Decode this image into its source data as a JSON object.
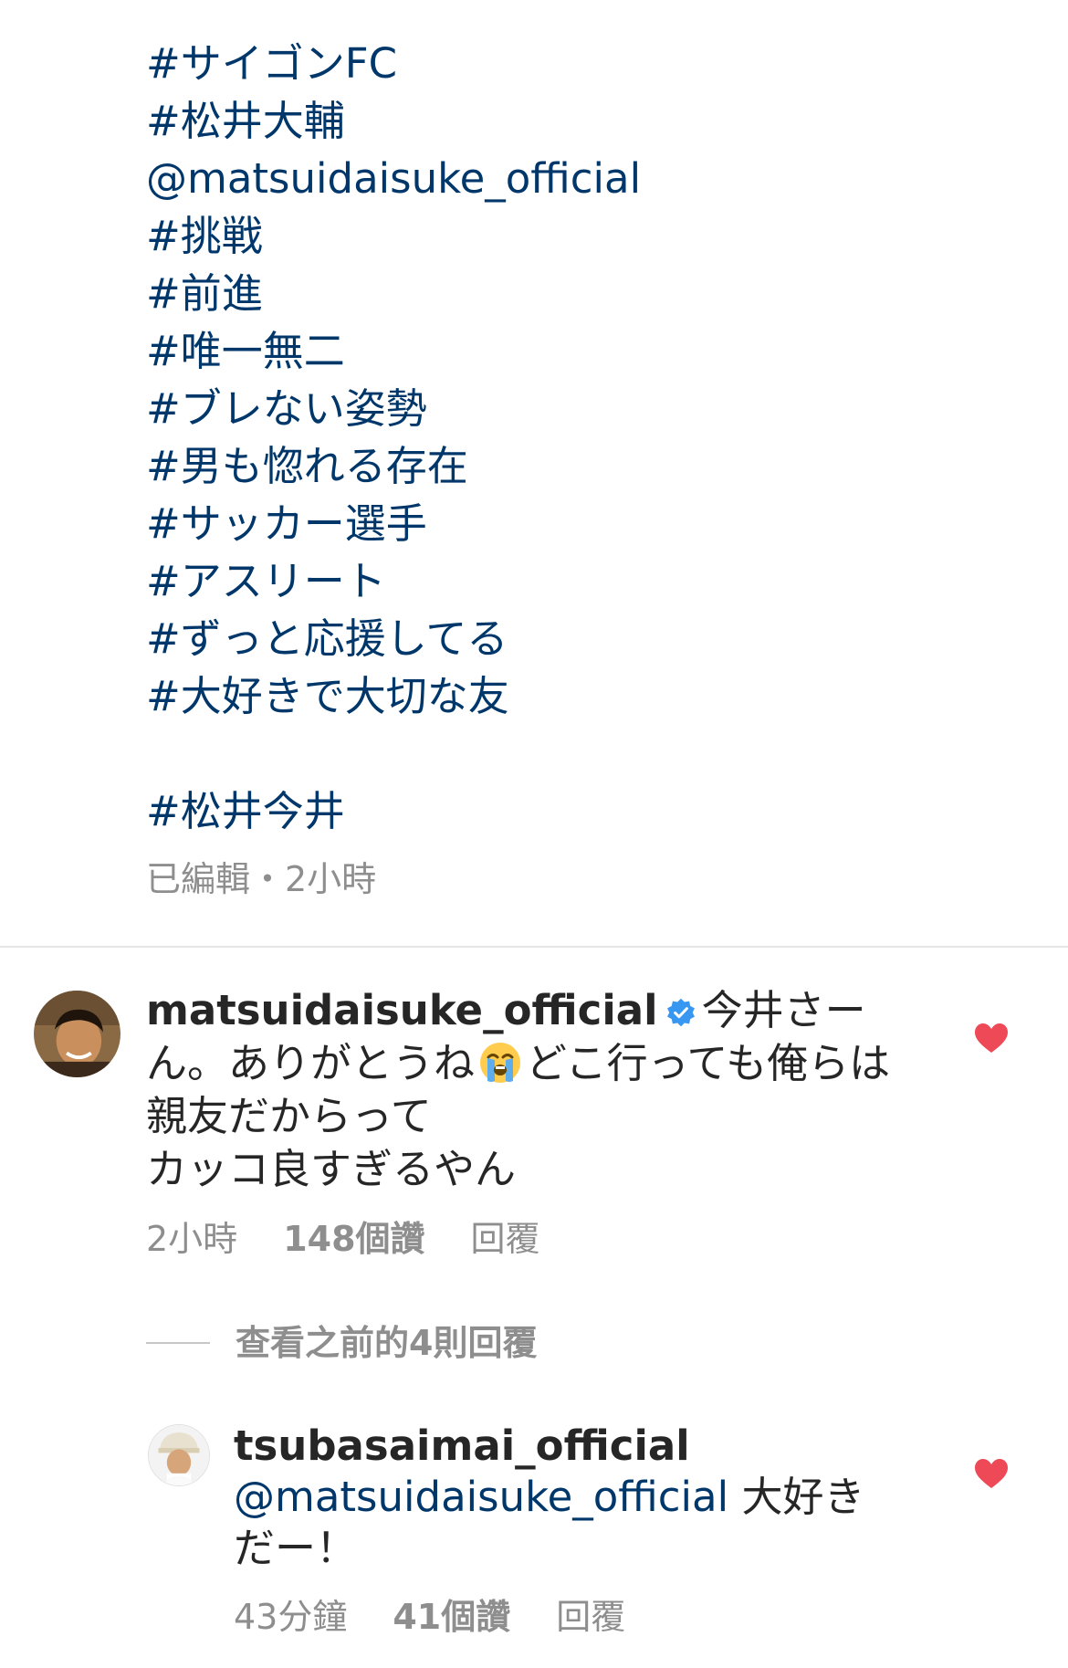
{
  "caption": {
    "lines": [
      "#サイゴンFC",
      "#松井大輔",
      "@matsuidaisuke_official",
      "#挑戦",
      "#前進",
      "#唯一無二",
      "#ブレない姿勢",
      "#男も惚れる存在",
      "#サッカー選手",
      "#アスリート",
      "#ずっと応援してる",
      "#大好きで大切な友"
    ],
    "last_line": "#松井今井",
    "meta": "已編輯・2小時"
  },
  "comment": {
    "username": "matsuidaisuke_official",
    "text_before_emoji": "今井さーん。ありがとうね",
    "text_after_emoji": "どこ行っても俺らは親友だからって",
    "text_line_last": "カッコ良すぎるやん",
    "time": "2小時",
    "likes": "148個讚",
    "reply": "回覆",
    "emoji_icon": "loudly-crying-face-emoji",
    "verified_icon": "verified-badge-icon"
  },
  "view_replies": "查看之前的4則回覆",
  "reply": {
    "username": "tsubasaimai_official",
    "mention": "@matsuidaisuke_official",
    "text": " 大好きだー！",
    "time": "43分鐘",
    "likes": "41個讚",
    "reply": "回覆"
  },
  "colors": {
    "link": "#00376b",
    "muted": "#8e8e8e",
    "heart": "#ed4956",
    "verified": "#3897f0"
  }
}
